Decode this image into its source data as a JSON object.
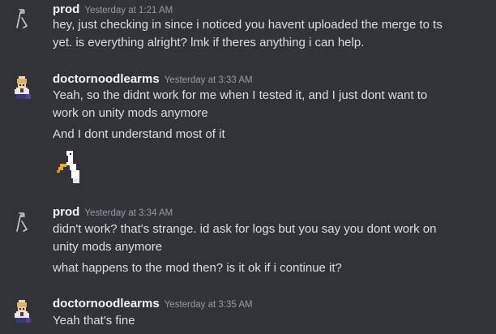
{
  "messages": [
    {
      "username": "prod",
      "timestamp": "Yesterday at 1:21 AM",
      "lines": [
        "hey, just checking in since i noticed you havent uploaded the merge to ts",
        "yet. is everything alright? lmk if theres anything i can help."
      ]
    },
    {
      "username": "doctornoodlearms",
      "timestamp": "Yesterday at 3:33 AM",
      "lines": [
        "Yeah, so the didnt work for me when I tested it, and I just dont want to",
        "work on unity mods anymore"
      ],
      "followups": [
        "And I dont understand most of it"
      ],
      "sticker": "goose-sticker"
    },
    {
      "username": "prod",
      "timestamp": "Yesterday at 3:34 AM",
      "lines": [
        "didn't work? that's strange. id ask for logs but you say you dont work on",
        "unity mods anymore"
      ],
      "followups": [
        "what happens to the mod then? is it ok if i continue it?"
      ]
    },
    {
      "username": "doctornoodlearms",
      "timestamp": "Yesterday at 3:35 AM",
      "lines": [
        "Yeah that's fine"
      ]
    }
  ],
  "icons": {
    "prod_avatar": "lambda-logo-icon",
    "doctor_avatar": "pixel-character-icon",
    "sticker": "goose-sticker-icon"
  },
  "colors": {
    "background": "#313338",
    "username": "#f2f3f5",
    "timestamp": "#949ba4",
    "text": "#dbdee1"
  }
}
